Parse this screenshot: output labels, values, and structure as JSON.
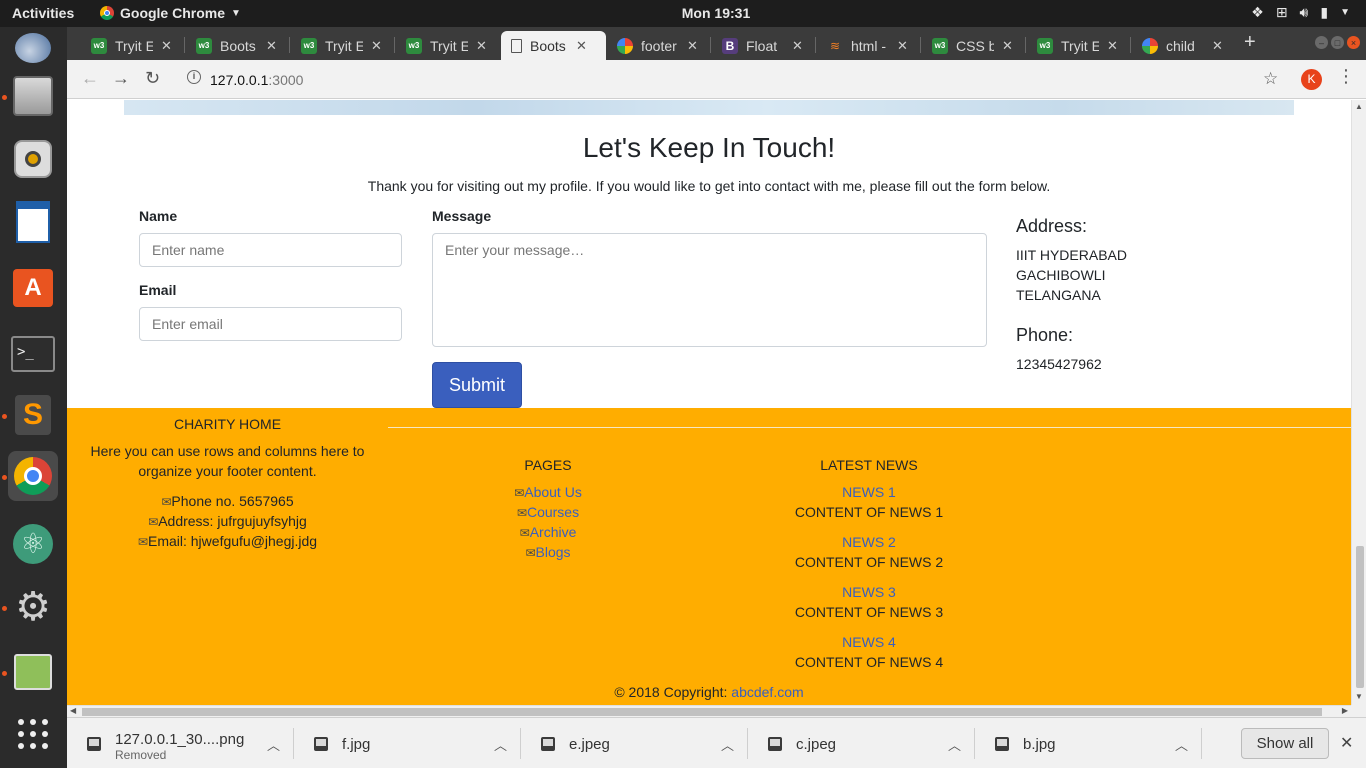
{
  "system": {
    "activities": "Activities",
    "app_name": "Google Chrome",
    "clock": "Mon 19:31"
  },
  "tabs": [
    {
      "label": "Tryit E",
      "icon": "w3schools-icon",
      "color": "#2e8b3e"
    },
    {
      "label": "Boots",
      "icon": "w3schools-icon",
      "color": "#2e8b3e"
    },
    {
      "label": "Tryit E",
      "icon": "w3schools-icon",
      "color": "#2e8b3e"
    },
    {
      "label": "Tryit E",
      "icon": "w3schools-icon",
      "color": "#2e8b3e"
    },
    {
      "label": "Boots",
      "icon": "page-icon",
      "color": "#ffffff",
      "active": true
    },
    {
      "label": "footer",
      "icon": "google-icon",
      "color": "#ffffff"
    },
    {
      "label": "Float",
      "icon": "bootstrap-icon",
      "color": "#563d7c"
    },
    {
      "label": "html -",
      "icon": "stackoverflow-icon",
      "color": "#f48024"
    },
    {
      "label": "CSS b",
      "icon": "w3schools-icon",
      "color": "#2e8b3e"
    },
    {
      "label": "Tryit E",
      "icon": "w3schools-icon",
      "color": "#2e8b3e"
    },
    {
      "label": "child",
      "icon": "google-icon",
      "color": "#ffffff"
    }
  ],
  "browser": {
    "url_host": "127.0.0.1",
    "url_port": ":3000",
    "profile_initial": "K"
  },
  "contact": {
    "title": "Let's Keep In Touch!",
    "subtitle": "Thank you for visiting out my profile. If you would like to get into contact with me, please fill out the form below.",
    "name_label": "Name",
    "name_placeholder": "Enter name",
    "email_label": "Email",
    "email_placeholder": "Enter email",
    "message_label": "Message",
    "message_placeholder": "Enter your message…",
    "submit_label": "Submit",
    "address_heading": "Address:",
    "address_lines": [
      "IIIT HYDERABAD",
      "GACHIBOWLI",
      "TELANGANA"
    ],
    "phone_heading": "Phone:",
    "phone": "12345427962"
  },
  "footer": {
    "brand": "CHARITY HOME",
    "intro_line1": "Here you can use rows and columns here to",
    "intro_line2": "organize your footer content.",
    "contact_items": [
      "Phone no. 5657965",
      "Address: jufrgujuyfsyhjg",
      "Email: hjwefgufu@jhegj.jdg"
    ],
    "pages_heading": "PAGES",
    "pages": [
      "About Us",
      "Courses",
      "Archive",
      "Blogs"
    ],
    "news_heading": "LATEST NEWS",
    "news": [
      {
        "title": "NEWS 1",
        "content": "CONTENT OF NEWS 1"
      },
      {
        "title": "NEWS 2",
        "content": "CONTENT OF NEWS 2"
      },
      {
        "title": "NEWS 3",
        "content": "CONTENT OF NEWS 3"
      },
      {
        "title": "NEWS 4",
        "content": "CONTENT OF NEWS 4"
      }
    ],
    "copyright": "© 2018 Copyright: ",
    "copyright_link": "abcdef.com",
    "bg_color": "#ffad00",
    "link_color": "#3a5fbe"
  },
  "downloads": {
    "items": [
      {
        "name": "127.0.0.1_30....png",
        "status": "Removed"
      },
      {
        "name": "f.jpg",
        "status": ""
      },
      {
        "name": "e.jpeg",
        "status": ""
      },
      {
        "name": "c.jpeg",
        "status": ""
      },
      {
        "name": "b.jpg",
        "status": ""
      }
    ],
    "show_all": "Show all"
  }
}
